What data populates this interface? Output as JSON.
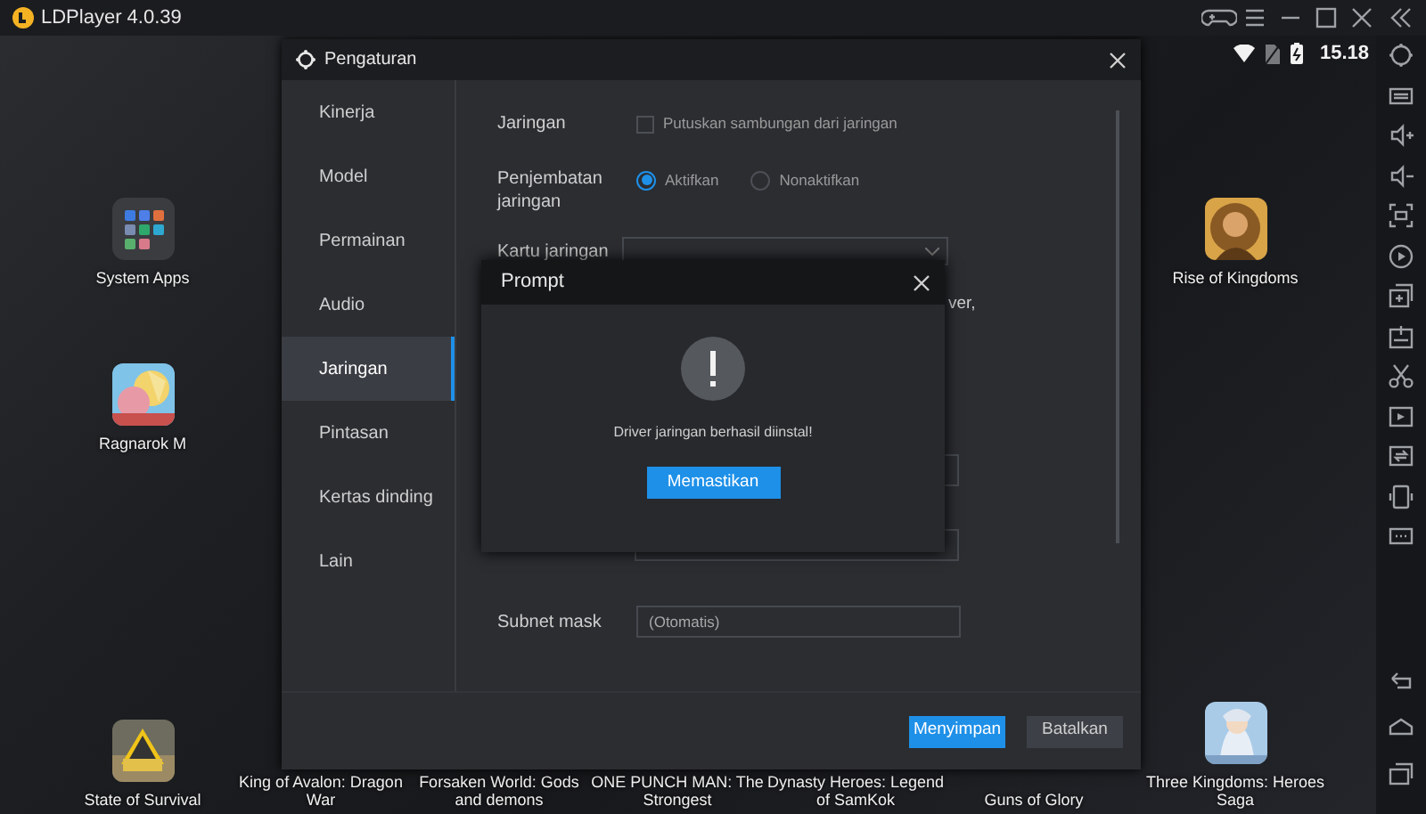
{
  "window": {
    "title": "LDPlayer 4.0.39"
  },
  "status_bar": {
    "time": "15.18"
  },
  "left_apps": [
    {
      "label": "System Apps",
      "kind": "folder"
    },
    {
      "label": "Ragnarok M",
      "kind": "picture"
    }
  ],
  "right_apps": [
    {
      "label": "Rise of Kingdoms",
      "kind": "picture"
    }
  ],
  "dock_apps": [
    {
      "label": "State of Survival",
      "kind": "picture"
    },
    {
      "label": "King of Avalon: Dragon War",
      "kind": "label"
    },
    {
      "label": "Forsaken World: Gods and demons",
      "kind": "label"
    },
    {
      "label": "ONE PUNCH MAN: The Strongest",
      "kind": "label"
    },
    {
      "label": "Dynasty Heroes: Legend of SamKok",
      "kind": "label"
    },
    {
      "label": "Guns of Glory",
      "kind": "label"
    },
    {
      "label": "Three Kingdoms: Heroes Saga",
      "kind": "picture"
    }
  ],
  "settings": {
    "title": "Pengaturan",
    "nav": [
      {
        "label": "Kinerja",
        "selected": false
      },
      {
        "label": "Model",
        "selected": false
      },
      {
        "label": "Permainan",
        "selected": false
      },
      {
        "label": "Audio",
        "selected": false
      },
      {
        "label": "Jaringan",
        "selected": true
      },
      {
        "label": "Pintasan",
        "selected": false
      },
      {
        "label": "Kertas dinding",
        "selected": false
      },
      {
        "label": "Lain",
        "selected": false
      }
    ],
    "network": {
      "label": "Jaringan",
      "option": "Putuskan sambungan dari jaringan",
      "checked": false
    },
    "bridge": {
      "label": "Penjembatan jaringan",
      "options": [
        {
          "label": "Aktifkan",
          "selected": true
        },
        {
          "label": "Nonaktifkan",
          "selected": false
        }
      ]
    },
    "card": {
      "label": "Kartu jaringan"
    },
    "note_fragment": "ver,",
    "subnet": {
      "label": "Subnet mask",
      "value": "(Otomatis)"
    },
    "buttons": [
      {
        "label": "Menyimpan",
        "kind": "primary"
      },
      {
        "label": "Batalkan",
        "kind": "secondary"
      }
    ]
  },
  "prompt": {
    "title": "Prompt",
    "message": "Driver jaringan berhasil diinstal!",
    "button": "Memastikan"
  }
}
